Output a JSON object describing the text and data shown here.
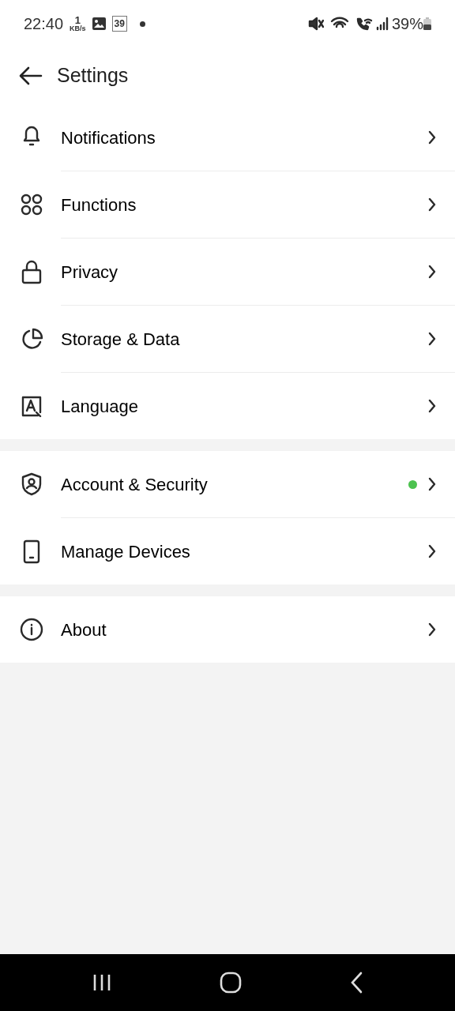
{
  "status_bar": {
    "time": "22:40",
    "speed_value": "1",
    "speed_unit": "KB/s",
    "notification_count": "39",
    "battery": "39%"
  },
  "header": {
    "title": "Settings"
  },
  "groups": [
    {
      "items": [
        {
          "label": "Notifications",
          "new_dot": false
        },
        {
          "label": "Functions",
          "new_dot": false
        },
        {
          "label": "Privacy",
          "new_dot": false
        },
        {
          "label": "Storage & Data",
          "new_dot": false
        },
        {
          "label": "Language",
          "new_dot": false
        }
      ]
    },
    {
      "items": [
        {
          "label": "Account & Security",
          "new_dot": true
        },
        {
          "label": "Manage Devices",
          "new_dot": false
        }
      ]
    },
    {
      "items": [
        {
          "label": "About",
          "new_dot": false
        }
      ]
    }
  ]
}
